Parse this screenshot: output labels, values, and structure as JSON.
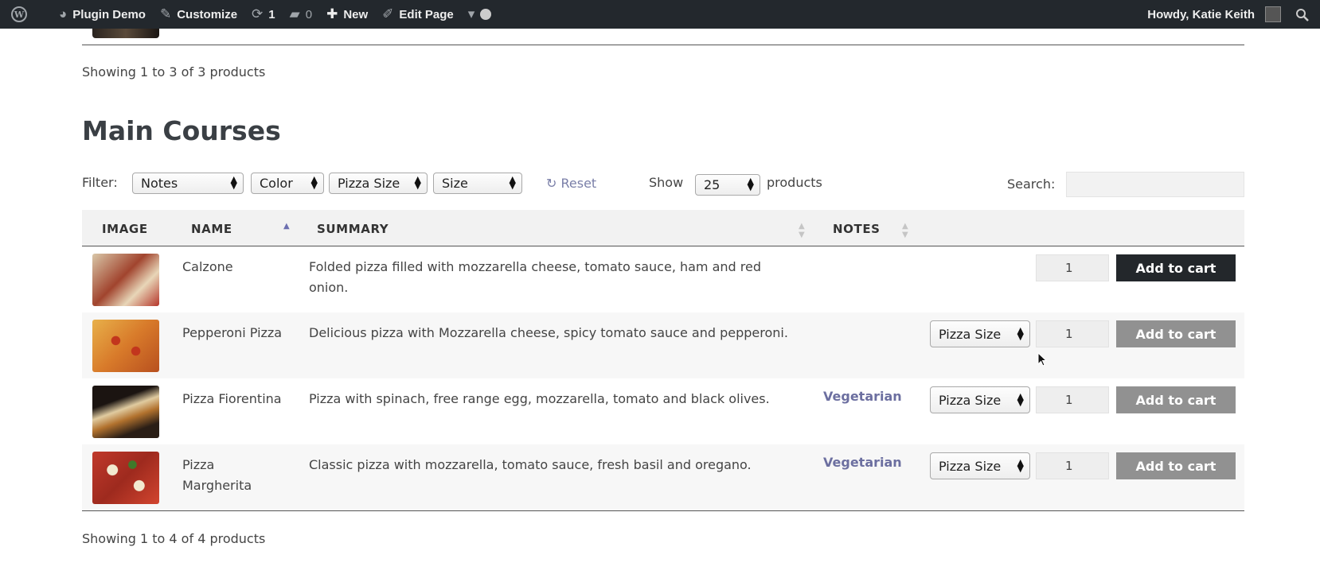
{
  "adminbar": {
    "site_name": "Plugin Demo",
    "customize": "Customize",
    "updates_count": "1",
    "comments_count": "0",
    "new_label": "New",
    "edit_page": "Edit Page",
    "greeting": "Howdy, Katie Keith"
  },
  "top_section": {
    "showing_text": "Showing 1 to 3 of 3 products"
  },
  "section": {
    "title": "Main Courses",
    "filter_label": "Filter:",
    "filters": [
      "Notes",
      "Color",
      "Pizza Size",
      "Size"
    ],
    "reset_label": "Reset",
    "show_label": "Show",
    "show_value": "25",
    "products_label": "products",
    "search_label": "Search:",
    "columns": {
      "image": "IMAGE",
      "name": "NAME",
      "summary": "SUMMARY",
      "notes": "NOTES"
    },
    "variation_select": "Pizza Size",
    "add_to_cart": "Add to cart",
    "rows": [
      {
        "name": "Calzone",
        "summary": "Folded pizza filled with mozzarella cheese, tomato sauce, ham and red onion.",
        "notes": "",
        "qty": "1"
      },
      {
        "name": "Pepperoni Pizza",
        "summary": "Delicious pizza with Mozzarella cheese, spicy tomato sauce and pepperoni.",
        "notes": "",
        "qty": "1"
      },
      {
        "name": "Pizza Fiorentina",
        "summary": "Pizza with spinach, free range egg, mozzarella, tomato and black olives.",
        "notes": "Vegetarian",
        "qty": "1"
      },
      {
        "name": "Pizza Margherita",
        "summary": "Classic pizza with mozzarella, tomato sauce, fresh basil and oregano.",
        "notes": "Vegetarian",
        "qty": "1"
      }
    ],
    "showing_text": "Showing 1 to 4 of 4 products"
  },
  "colors": {
    "adminbar_bg": "#23282d",
    "link_purple": "#6c6fa0",
    "button_dark": "#23272b",
    "button_grey": "#919191"
  }
}
